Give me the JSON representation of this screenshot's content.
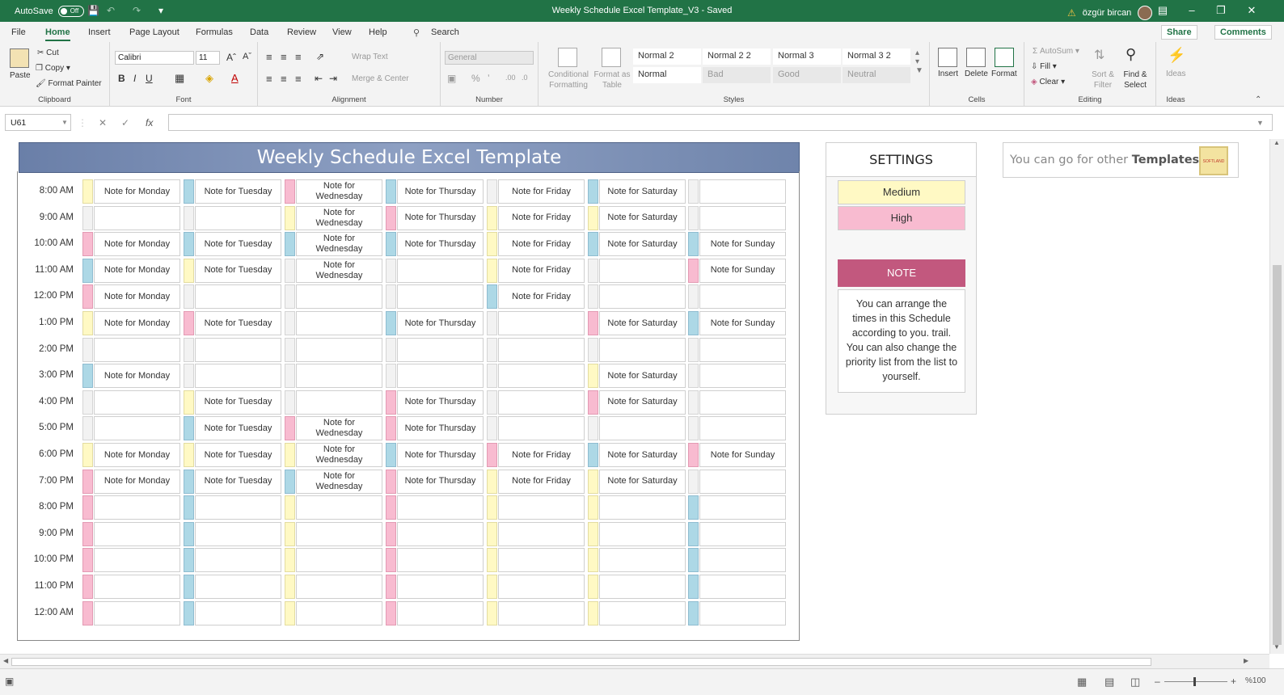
{
  "titlebar": {
    "autosave_label": "AutoSave",
    "autosave_state": "Off",
    "doc_title": "Weekly Schedule Excel Template_V3  -  Saved",
    "user_name": "özgür bircan"
  },
  "menu": {
    "tabs": [
      "File",
      "Home",
      "Insert",
      "Page Layout",
      "Formulas",
      "Data",
      "Review",
      "View",
      "Help"
    ],
    "search": "Search",
    "share": "Share",
    "comments": "Comments"
  },
  "ribbon": {
    "clipboard": {
      "paste": "Paste",
      "cut": "Cut",
      "copy": "Copy",
      "format_painter": "Format Painter",
      "label": "Clipboard"
    },
    "font": {
      "name": "Calibri",
      "size": "11",
      "label": "Font"
    },
    "alignment": {
      "wrap": "Wrap Text",
      "merge": "Merge & Center",
      "label": "Alignment"
    },
    "number": {
      "format": "General",
      "label": "Number"
    },
    "styles": {
      "conditional": "Conditional Formatting",
      "format_table": "Format as Table",
      "cells": [
        "Normal 2",
        "Normal 2 2",
        "Normal 3",
        "Normal 3 2",
        "Normal",
        "Bad",
        "Good",
        "Neutral"
      ],
      "label": "Styles"
    },
    "cells": {
      "insert": "Insert",
      "delete": "Delete",
      "format": "Format",
      "label": "Cells"
    },
    "editing": {
      "autosum": "AutoSum",
      "fill": "Fill",
      "clear": "Clear",
      "sort": "Sort & Filter",
      "find": "Find & Select",
      "label": "Editing"
    },
    "ideas": {
      "ideas": "Ideas",
      "label": "Ideas"
    }
  },
  "formula": {
    "namebox": "U61",
    "value": ""
  },
  "sheet": {
    "title": "Weekly Schedule Excel Template",
    "rows": [
      {
        "time": "8:00 AM",
        "cells": [
          [
            "yellow",
            "Note for Monday"
          ],
          [
            "blue",
            "Note for Tuesday"
          ],
          [
            "pink",
            "Note for Wednesday"
          ],
          [
            "blue",
            "Note for Thursday"
          ],
          [
            "gray",
            "Note for Friday"
          ],
          [
            "blue",
            "Note for Saturday"
          ],
          [
            "gray",
            ""
          ]
        ]
      },
      {
        "time": "9:00 AM",
        "cells": [
          [
            "gray",
            ""
          ],
          [
            "gray",
            ""
          ],
          [
            "yellow",
            "Note for Wednesday"
          ],
          [
            "pink",
            "Note for Thursday"
          ],
          [
            "yellow",
            "Note for Friday"
          ],
          [
            "yellow",
            "Note for Saturday"
          ],
          [
            "gray",
            ""
          ]
        ]
      },
      {
        "time": "10:00 AM",
        "cells": [
          [
            "pink",
            "Note for Monday"
          ],
          [
            "blue",
            "Note for Tuesday"
          ],
          [
            "blue",
            "Note for Wednesday"
          ],
          [
            "blue",
            "Note for Thursday"
          ],
          [
            "yellow",
            "Note for Friday"
          ],
          [
            "blue",
            "Note for Saturday"
          ],
          [
            "blue",
            "Note for Sunday"
          ]
        ]
      },
      {
        "time": "11:00 AM",
        "cells": [
          [
            "blue",
            "Note for Monday"
          ],
          [
            "yellow",
            "Note for Tuesday"
          ],
          [
            "gray",
            "Note for Wednesday"
          ],
          [
            "gray",
            ""
          ],
          [
            "yellow",
            "Note for Friday"
          ],
          [
            "gray",
            ""
          ],
          [
            "pink",
            "Note for Sunday"
          ]
        ]
      },
      {
        "time": "12:00 PM",
        "cells": [
          [
            "pink",
            "Note for Monday"
          ],
          [
            "gray",
            ""
          ],
          [
            "gray",
            ""
          ],
          [
            "gray",
            ""
          ],
          [
            "blue",
            "Note for Friday"
          ],
          [
            "gray",
            ""
          ],
          [
            "gray",
            ""
          ]
        ]
      },
      {
        "time": "1:00 PM",
        "cells": [
          [
            "yellow",
            "Note for Monday"
          ],
          [
            "pink",
            "Note for Tuesday"
          ],
          [
            "gray",
            ""
          ],
          [
            "blue",
            "Note for Thursday"
          ],
          [
            "gray",
            ""
          ],
          [
            "pink",
            "Note for Saturday"
          ],
          [
            "blue",
            "Note for Sunday"
          ]
        ]
      },
      {
        "time": "2:00 PM",
        "cells": [
          [
            "gray",
            ""
          ],
          [
            "gray",
            ""
          ],
          [
            "gray",
            ""
          ],
          [
            "gray",
            ""
          ],
          [
            "gray",
            ""
          ],
          [
            "gray",
            ""
          ],
          [
            "gray",
            ""
          ]
        ]
      },
      {
        "time": "3:00 PM",
        "cells": [
          [
            "blue",
            "Note for Monday"
          ],
          [
            "gray",
            ""
          ],
          [
            "gray",
            ""
          ],
          [
            "gray",
            ""
          ],
          [
            "gray",
            ""
          ],
          [
            "yellow",
            "Note for Saturday"
          ],
          [
            "gray",
            ""
          ]
        ]
      },
      {
        "time": "4:00 PM",
        "cells": [
          [
            "gray",
            ""
          ],
          [
            "yellow",
            "Note for Tuesday"
          ],
          [
            "gray",
            ""
          ],
          [
            "pink",
            "Note for Thursday"
          ],
          [
            "gray",
            ""
          ],
          [
            "pink",
            "Note for Saturday"
          ],
          [
            "gray",
            ""
          ]
        ]
      },
      {
        "time": "5:00 PM",
        "cells": [
          [
            "gray",
            ""
          ],
          [
            "blue",
            "Note for Tuesday"
          ],
          [
            "pink",
            "Note for Wednesday"
          ],
          [
            "pink",
            "Note for Thursday"
          ],
          [
            "gray",
            ""
          ],
          [
            "gray",
            ""
          ],
          [
            "gray",
            ""
          ]
        ]
      },
      {
        "time": "6:00 PM",
        "cells": [
          [
            "yellow",
            "Note for Monday"
          ],
          [
            "yellow",
            "Note for Tuesday"
          ],
          [
            "yellow",
            "Note for Wednesday"
          ],
          [
            "blue",
            "Note for Thursday"
          ],
          [
            "pink",
            "Note for Friday"
          ],
          [
            "blue",
            "Note for Saturday"
          ],
          [
            "pink",
            "Note for Sunday"
          ]
        ]
      },
      {
        "time": "7:00 PM",
        "cells": [
          [
            "pink",
            "Note for Monday"
          ],
          [
            "blue",
            "Note for Tuesday"
          ],
          [
            "blue",
            "Note for Wednesday"
          ],
          [
            "pink",
            "Note for Thursday"
          ],
          [
            "yellow",
            "Note for Friday"
          ],
          [
            "yellow",
            "Note for Saturday"
          ],
          [
            "gray",
            ""
          ]
        ]
      },
      {
        "time": "8:00 PM",
        "cells": [
          [
            "pink",
            ""
          ],
          [
            "blue",
            ""
          ],
          [
            "yellow",
            ""
          ],
          [
            "pink",
            ""
          ],
          [
            "yellow",
            ""
          ],
          [
            "yellow",
            ""
          ],
          [
            "blue",
            ""
          ]
        ]
      },
      {
        "time": "9:00 PM",
        "cells": [
          [
            "pink",
            ""
          ],
          [
            "blue",
            ""
          ],
          [
            "yellow",
            ""
          ],
          [
            "pink",
            ""
          ],
          [
            "yellow",
            ""
          ],
          [
            "yellow",
            ""
          ],
          [
            "blue",
            ""
          ]
        ]
      },
      {
        "time": "10:00 PM",
        "cells": [
          [
            "pink",
            ""
          ],
          [
            "blue",
            ""
          ],
          [
            "yellow",
            ""
          ],
          [
            "pink",
            ""
          ],
          [
            "yellow",
            ""
          ],
          [
            "yellow",
            ""
          ],
          [
            "blue",
            ""
          ]
        ]
      },
      {
        "time": "11:00 PM",
        "cells": [
          [
            "pink",
            ""
          ],
          [
            "blue",
            ""
          ],
          [
            "yellow",
            ""
          ],
          [
            "pink",
            ""
          ],
          [
            "yellow",
            ""
          ],
          [
            "yellow",
            ""
          ],
          [
            "blue",
            ""
          ]
        ]
      },
      {
        "time": "12:00 AM",
        "cells": [
          [
            "pink",
            ""
          ],
          [
            "blue",
            ""
          ],
          [
            "yellow",
            ""
          ],
          [
            "pink",
            ""
          ],
          [
            "yellow",
            ""
          ],
          [
            "yellow",
            ""
          ],
          [
            "blue",
            ""
          ]
        ]
      }
    ]
  },
  "settings": {
    "title": "SETTINGS",
    "priorities": [
      {
        "label": "Medium",
        "color": "#fff9c4"
      },
      {
        "label": "High",
        "color": "#f8bbd0"
      }
    ],
    "note_title": "NOTE",
    "note_text": "You can arrange the times in this Schedule according to you. trail. You can also change the priority list from the list to yourself."
  },
  "templates": {
    "prefix": "You can go for other ",
    "bold": "Templates",
    "logo_text": "SOFTLAND"
  },
  "status": {
    "zoom": "%100"
  }
}
